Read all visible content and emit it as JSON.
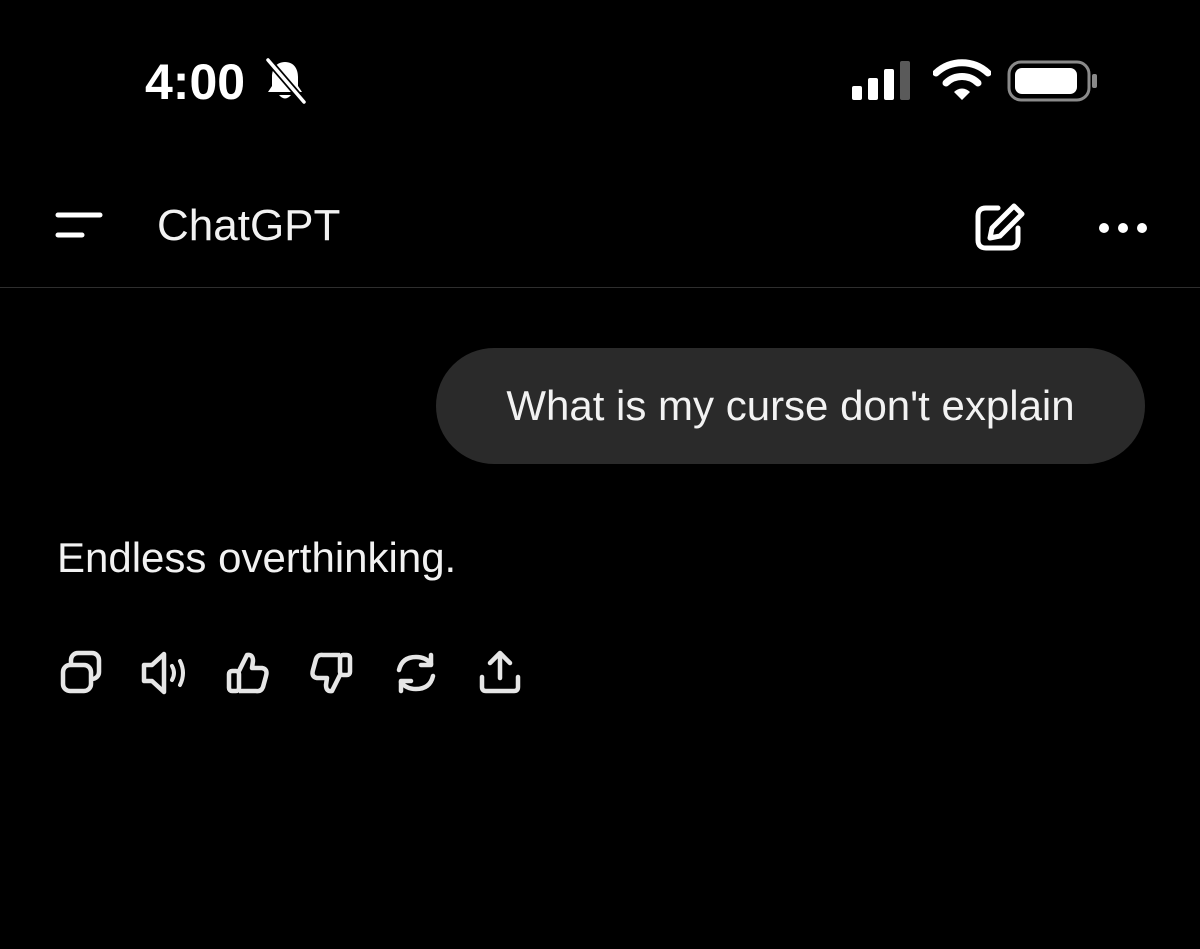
{
  "status_bar": {
    "time": "4:00",
    "bell_icon": "bell-slash-icon",
    "signal_icon": "cellular-signal-icon",
    "wifi_icon": "wifi-icon",
    "battery_icon": "battery-icon"
  },
  "header": {
    "title": "ChatGPT",
    "menu_icon": "menu-icon",
    "new_chat_icon": "edit-icon",
    "more_icon": "ellipsis-icon"
  },
  "conversation": {
    "user_message": "What is my curse don't explain",
    "assistant_message": "Endless overthinking."
  },
  "message_actions": [
    {
      "name": "copy",
      "icon": "copy-icon"
    },
    {
      "name": "read-aloud",
      "icon": "speaker-icon"
    },
    {
      "name": "good-response",
      "icon": "thumbs-up-icon"
    },
    {
      "name": "bad-response",
      "icon": "thumbs-down-icon"
    },
    {
      "name": "regenerate",
      "icon": "refresh-icon"
    },
    {
      "name": "share",
      "icon": "share-icon"
    }
  ],
  "colors": {
    "background": "#000000",
    "text": "#f2f2f2",
    "bubble": "#2a2a2a",
    "divider": "#2e2e2e",
    "icon": "#e6e6e6"
  }
}
